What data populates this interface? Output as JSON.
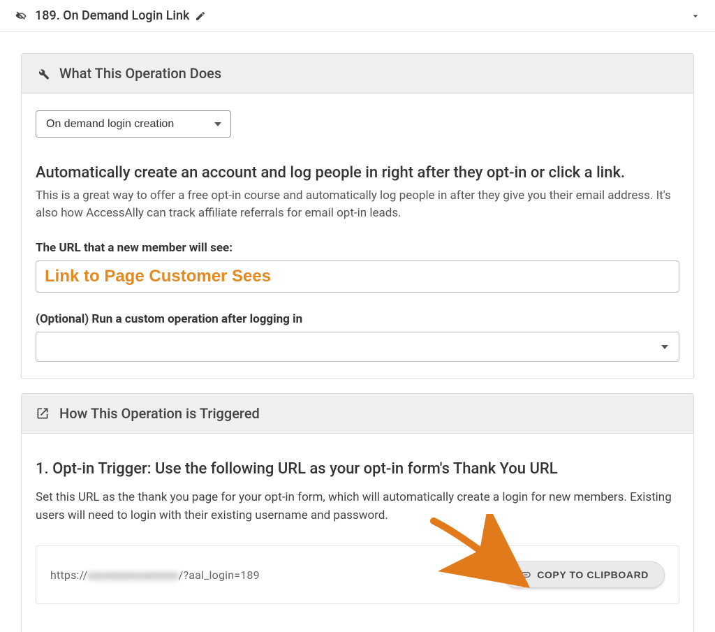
{
  "header": {
    "title": "189. On Demand Login Link"
  },
  "panel1": {
    "title": "What This Operation Does",
    "select_value": "On demand login creation",
    "headline": "Automatically create an account and log people in right after they opt-in or click a link.",
    "desc": "This is a great way to offer a free opt-in course and automatically log people in after they give you their email address. It's also how AccessAlly can track affiliate referrals for email opt-in leads.",
    "url_label": "The URL that a new member will see:",
    "url_input_value": "Link to Page Customer Sees",
    "optional_label": "(Optional) Run a custom operation after logging in"
  },
  "panel2": {
    "title": "How This Operation is Triggered",
    "step1_title": "1. Opt-in Trigger: Use the following URL as your opt-in form's Thank You URL",
    "step1_desc": "Set this URL as the thank you page for your opt-in form, which will automatically create a login for new members. Existing users will need to login with their existing username and password.",
    "url_prefix": "https://",
    "url_blur": "xxxxxxxxxxxxxxxx",
    "url_suffix": "/?aal_login=189",
    "copy_label": "COPY TO CLIPBOARD"
  }
}
